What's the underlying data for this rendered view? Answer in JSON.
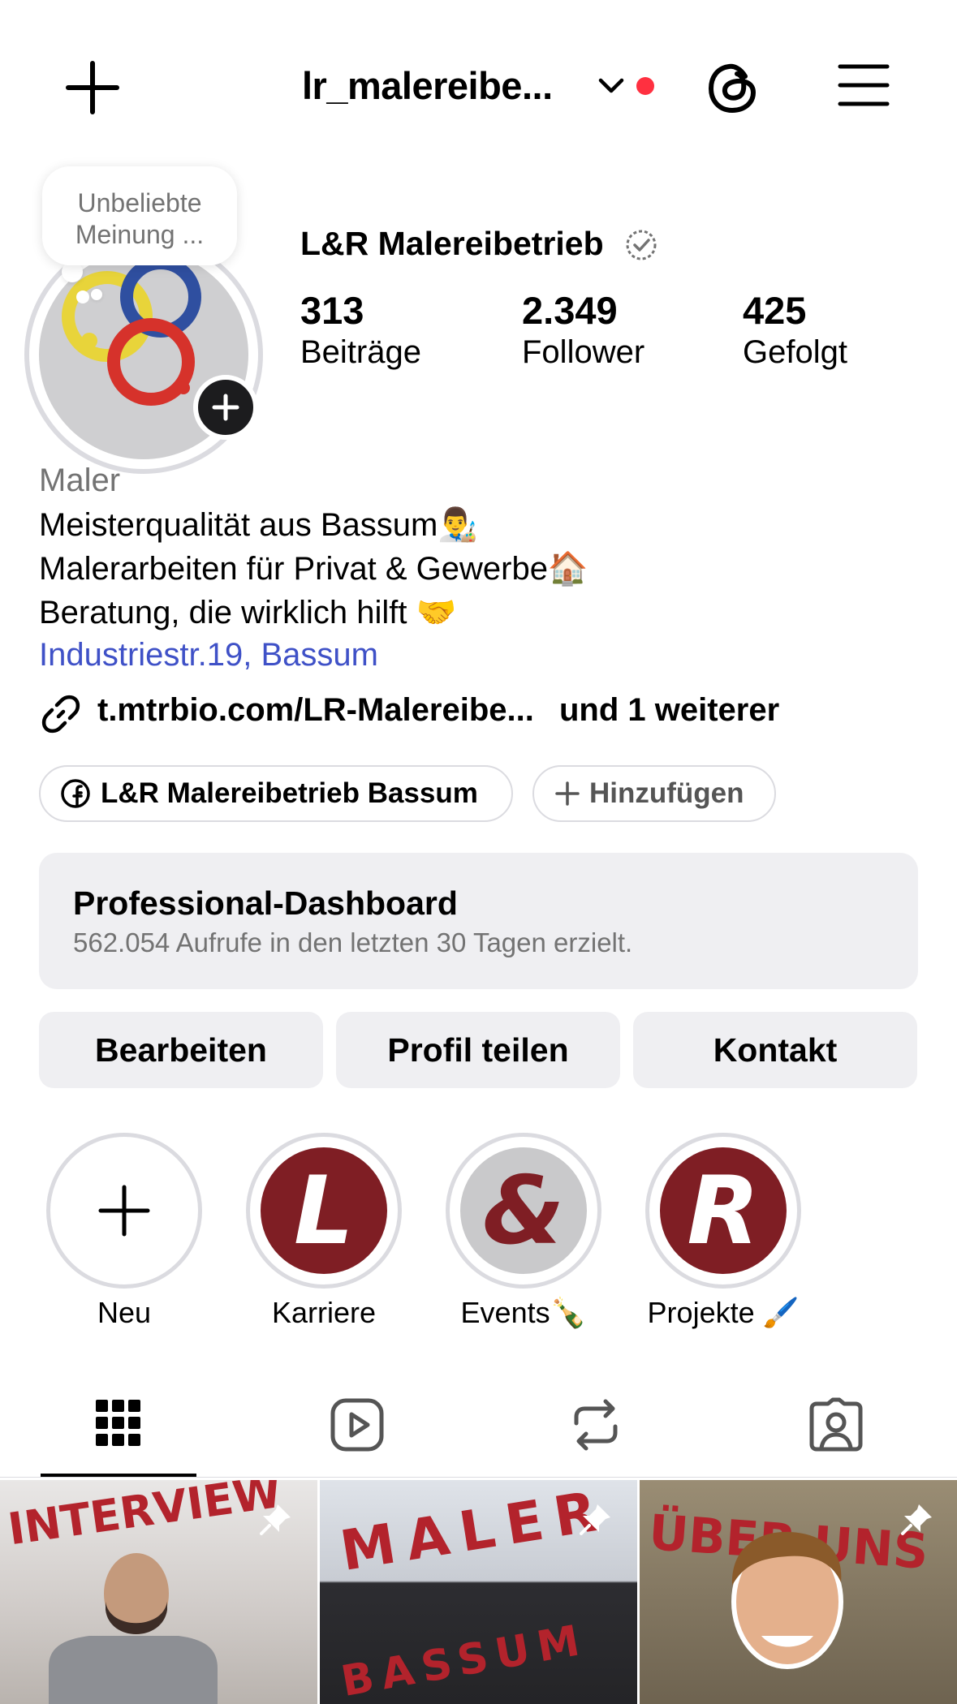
{
  "topbar": {
    "username": "lr_malereibe...",
    "new_post_icon": "plus-icon",
    "dropdown_icon": "chevron-down-icon",
    "notification_dot_color": "#ff3040",
    "threads_icon": "threads-icon",
    "menu_icon": "hamburger-menu-icon"
  },
  "note": {
    "line1": "Unbeliebte",
    "line2": "Meinung ..."
  },
  "profile": {
    "display_name": "L&R Malereibetrieb",
    "verified_icon": "verified-badge-icon",
    "stats": [
      {
        "value": "313",
        "label": "Beiträge"
      },
      {
        "value": "2.349",
        "label": "Follower"
      },
      {
        "value": "425",
        "label": "Gefolgt"
      }
    ]
  },
  "bio": {
    "category": "Maler",
    "line1": "Meisterqualität aus Bassum👨‍🎨",
    "line2": "Malerarbeiten für Privat & Gewerbe🏠",
    "line3": "Beratung, die wirklich hilft 🤝",
    "address": "Industriestr.19, Bassum",
    "link": "t.mtrbio.com/LR-Malereibe...",
    "link_more": "und 1 weiterer"
  },
  "pills": {
    "facebook": "L&R Malereibetrieb Bassum",
    "add": "Hinzufügen"
  },
  "dashboard": {
    "title": "Professional-Dashboard",
    "subtitle": "562.054 Aufrufe in den letzten 30 Tagen erzielt."
  },
  "buttons": {
    "edit": "Bearbeiten",
    "share": "Profil teilen",
    "contact": "Kontakt"
  },
  "highlights": [
    {
      "label": "Neu",
      "glyph": ""
    },
    {
      "label": "Karriere",
      "glyph": "L"
    },
    {
      "label": "Events🍾",
      "glyph": "&"
    },
    {
      "label": "Projekte 🖌️",
      "glyph": "R"
    }
  ],
  "tabs": [
    "grid-icon",
    "reels-icon",
    "reposts-icon",
    "tagged-icon"
  ],
  "posts": [
    {
      "caption": "INTERVIEW"
    },
    {
      "caption1": "MALER",
      "caption2": "BASSUM"
    },
    {
      "caption": "ÜBER UNS"
    }
  ],
  "colors": {
    "accent_red": "#7f1e24",
    "link_blue": "#3f51c7",
    "muted": "#737373"
  }
}
